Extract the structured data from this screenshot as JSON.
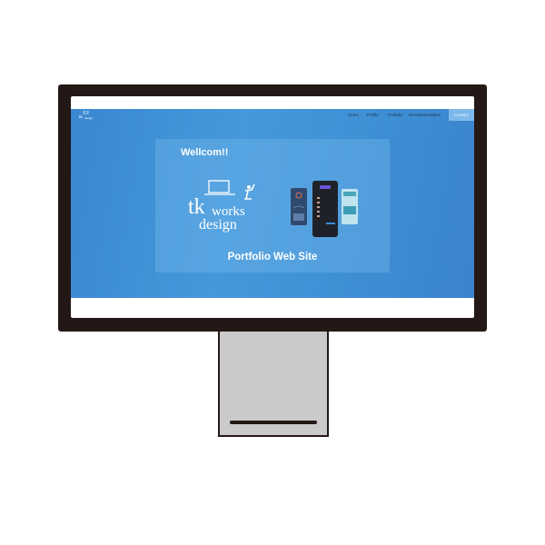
{
  "nav": {
    "items": [
      {
        "label": "Home"
      },
      {
        "label": "Profile"
      },
      {
        "label": "Portfolio"
      },
      {
        "label": "Recommendation"
      }
    ],
    "contact_label": "Contact"
  },
  "hero": {
    "welcome": "Wellcom!!",
    "logo_text": "tk works design",
    "subtitle": "Portfolio Web Site"
  },
  "colors": {
    "frame": "#231815",
    "hero_blue": "#4698da",
    "contact_button": "#7db9ea",
    "stand": "#cacaca"
  }
}
